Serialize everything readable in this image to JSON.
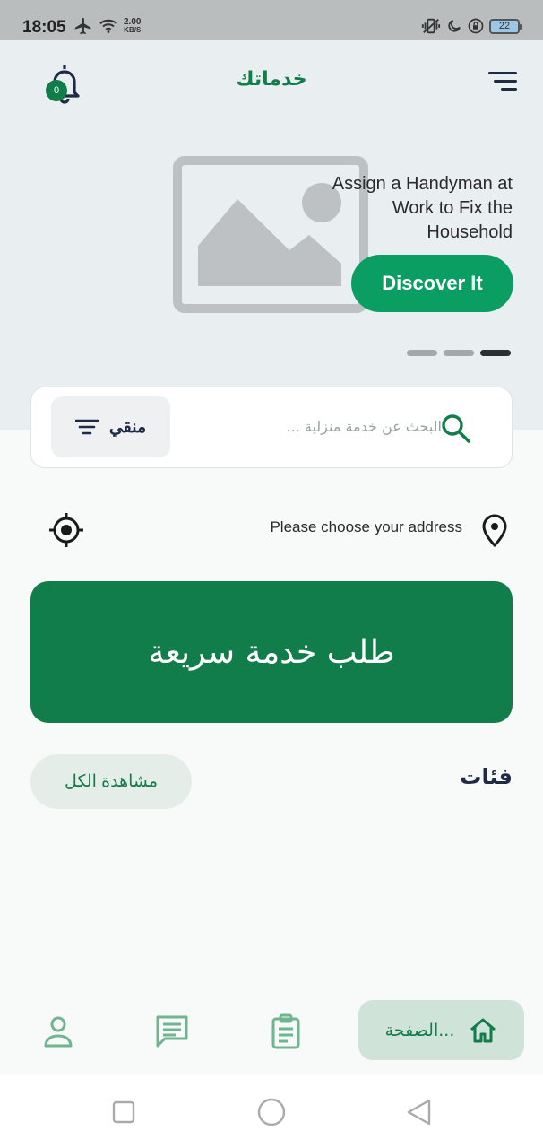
{
  "status_bar": {
    "time": "18:05",
    "speed_value": "2.00",
    "speed_unit": "KB/S",
    "battery": "22"
  },
  "header": {
    "title": "خدماتك",
    "notification_count": "0"
  },
  "banner": {
    "text": "Assign a Handyman at Work to Fix the Household",
    "button_label": "Discover It",
    "slides": 3,
    "active_slide": 3
  },
  "search": {
    "placeholder": "البحث عن خدمة منزلية ...",
    "filter_label": "منقي"
  },
  "address": {
    "text": "Please choose your address"
  },
  "quick_service": {
    "label": "طلب خدمة سريعة"
  },
  "categories": {
    "title": "فئات",
    "view_all_label": "مشاهدة الكل"
  },
  "bottom_nav": {
    "home_label": "الصفحة...",
    "items": [
      "home-icon",
      "orders-icon",
      "messages-icon",
      "profile-icon"
    ]
  },
  "colors": {
    "primary": "#117d4a",
    "accent": "#0b9e63",
    "dark": "#1f2a44"
  }
}
